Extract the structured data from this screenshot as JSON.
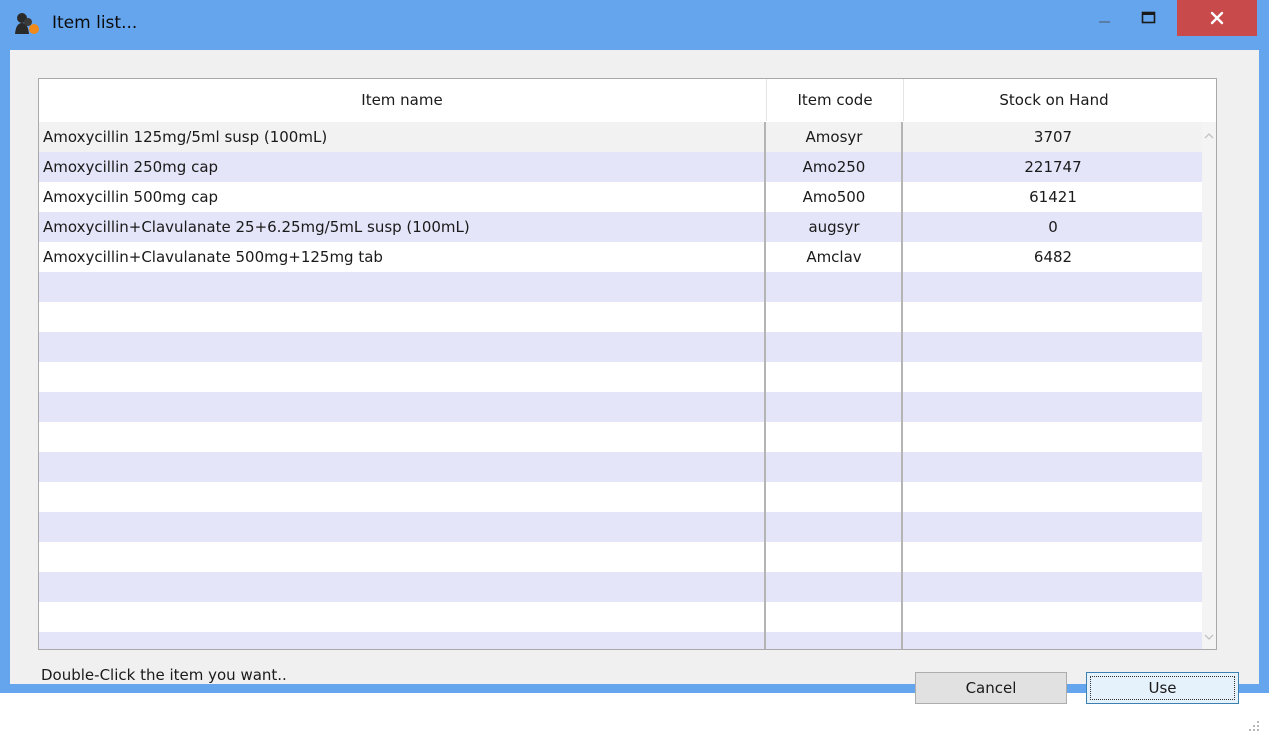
{
  "window": {
    "title": "Item list..."
  },
  "table": {
    "columns": [
      "Item name",
      "Item code",
      "Stock on Hand"
    ],
    "rows": [
      {
        "name": "Amoxycillin 125mg/5ml susp (100mL)",
        "code": "Amosyr",
        "stock": "3707"
      },
      {
        "name": "Amoxycillin 250mg cap",
        "code": "Amo250",
        "stock": "221747"
      },
      {
        "name": "Amoxycillin 500mg cap",
        "code": "Amo500",
        "stock": "61421"
      },
      {
        "name": "Amoxycillin+Clavulanate 25+6.25mg/5mL susp (100mL)",
        "code": "augsyr",
        "stock": "0"
      },
      {
        "name": "Amoxycillin+Clavulanate 500mg+125mg tab",
        "code": "Amclav",
        "stock": "6482"
      }
    ]
  },
  "hint": "Double-Click the item you want..",
  "buttons": {
    "cancel": "Cancel",
    "use": "Use"
  },
  "colors": {
    "titlebar": "#65a5ee",
    "close_button": "#c94a4a",
    "row_stripe": "#e4e5f9"
  }
}
